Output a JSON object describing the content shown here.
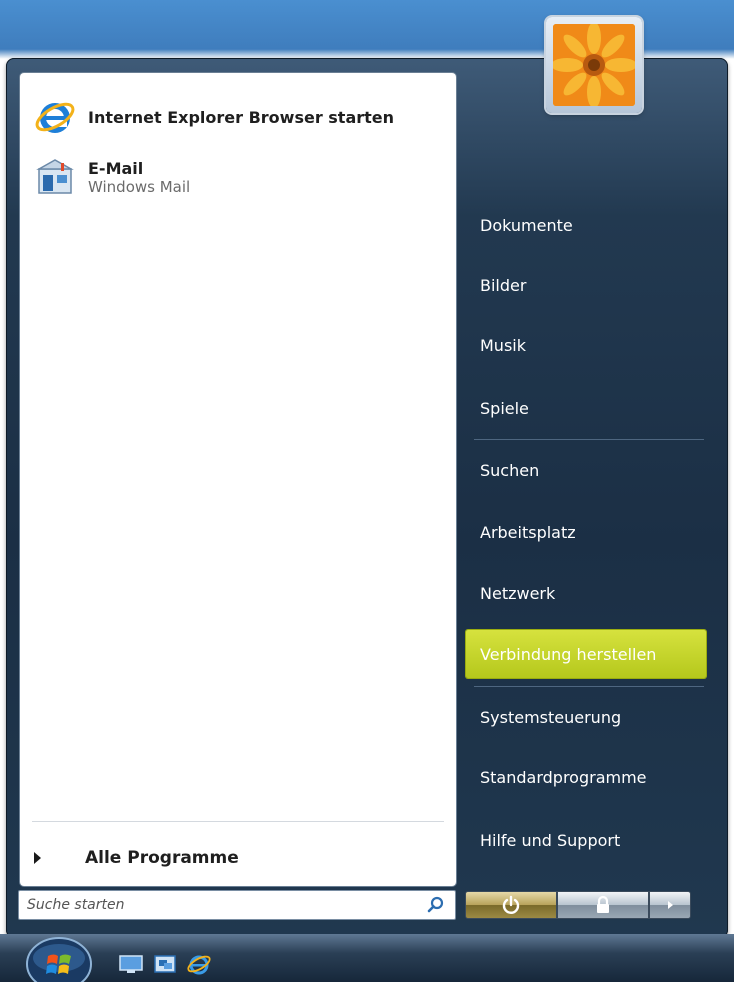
{
  "left_panel": {
    "pinned": [
      {
        "title": "Internet Explorer Browser starten",
        "icon": "internet-explorer-icon"
      },
      {
        "title": "E-Mail",
        "subtitle": "Windows Mail",
        "icon": "windows-mail-icon"
      }
    ],
    "all_programs_label": "Alle Programme"
  },
  "search": {
    "placeholder": "Suche starten",
    "icon": "search-icon"
  },
  "user": {
    "avatar_icon": "flower-avatar"
  },
  "right_panel": {
    "items": [
      "Dokumente",
      "Bilder",
      "Musik",
      "Spiele",
      "Suchen",
      "Arbeitsplatz",
      "Netzwerk",
      "Verbindung herstellen",
      "Systemsteuerung",
      "Standardprogramme",
      "Hilfe und Support"
    ],
    "highlighted": "Verbindung herstellen",
    "highlight_color": "#c8d72c"
  },
  "power": {
    "buttons": [
      {
        "icon": "power-icon"
      },
      {
        "icon": "lock-icon"
      },
      {
        "icon": "arrow-right-icon"
      }
    ]
  },
  "taskbar": {
    "start_icon": "windows-orb-icon",
    "quick_launch": [
      "show-desktop-icon",
      "switch-windows-icon",
      "internet-explorer-icon"
    ]
  },
  "colors": {
    "menu_bg": "#1b2f45",
    "panel_bg": "#ffffff",
    "accent": "#c8d72c"
  }
}
